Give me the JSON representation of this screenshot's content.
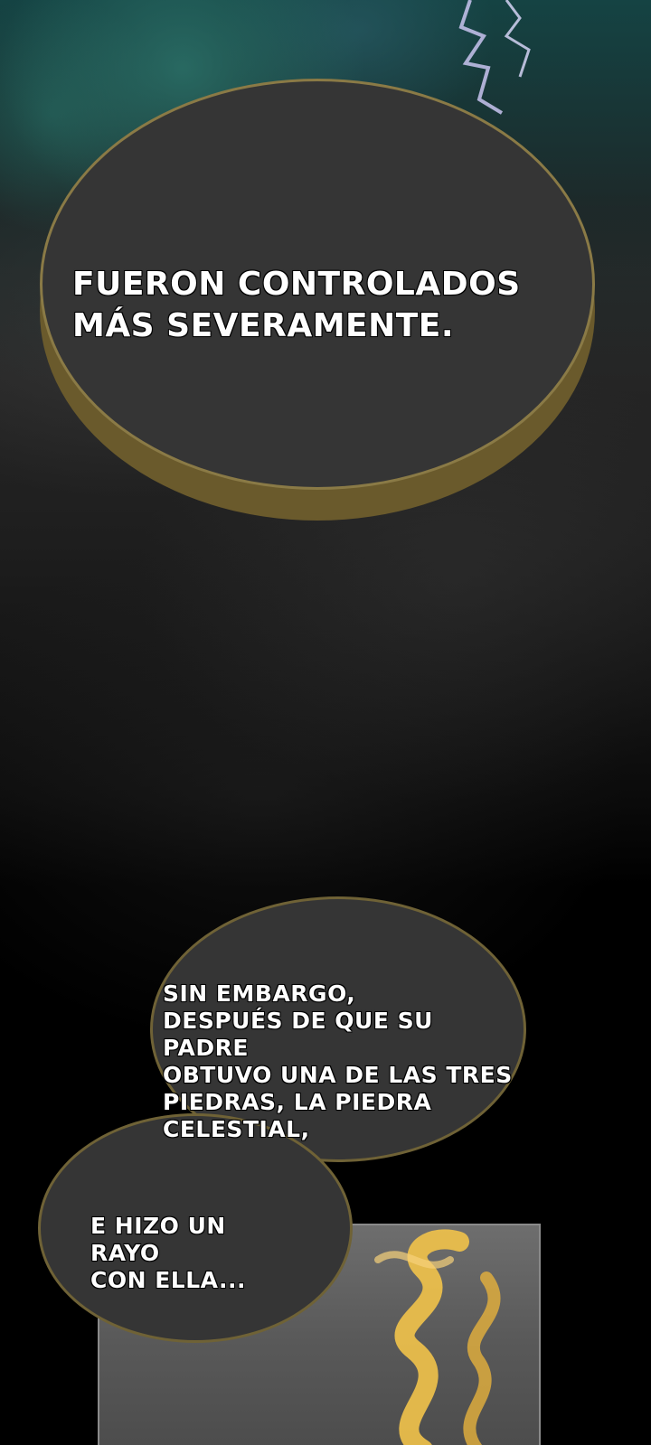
{
  "bubbles": [
    {
      "text": "FUERON CONTROLADOS\nMÁS SEVERAMENTE."
    },
    {
      "text": "SIN EMBARGO,\nDESPUÉS DE QUE SU PADRE\nOBTUVO UNA DE LAS TRES\nPIEDRAS, LA PIEDRA\nCELESTIAL,"
    },
    {
      "text": "E HIZO UN RAYO\nCON ELLA..."
    }
  ],
  "colors": {
    "bubble_fill": "#353535",
    "bubble_border": "#8a7a46",
    "text": "#ffffff",
    "flame": "#f2c34a"
  }
}
